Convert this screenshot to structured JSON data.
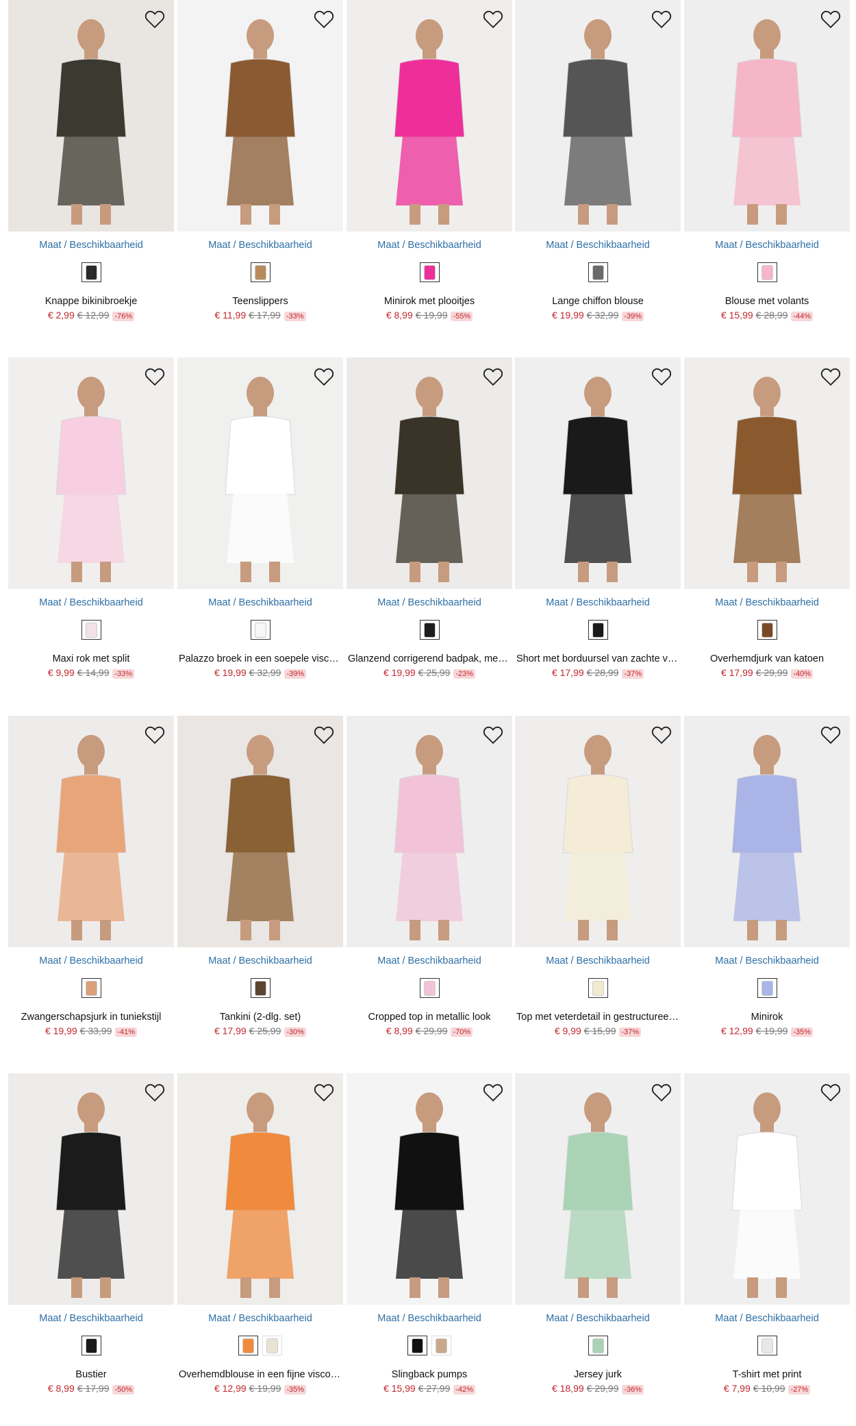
{
  "availability_label": "Maat / Beschikbaarheid",
  "products": [
    {
      "name": "Knappe bikinibroekje",
      "price": "€ 2,99",
      "old_price": "€ 12,99",
      "discount": "-76%",
      "bg": "#e9e6e2",
      "garment": "#3c3a30",
      "swatches": [
        "#2a2a2a"
      ]
    },
    {
      "name": "Teenslippers",
      "price": "€ 11,99",
      "old_price": "€ 17,99",
      "discount": "-33%",
      "bg": "#f3f3f3",
      "garment": "#8a5a32",
      "swatches": [
        "#b88a5c"
      ]
    },
    {
      "name": "Minirok met plooitjes",
      "price": "€ 8,99",
      "old_price": "€ 19,99",
      "discount": "-55%",
      "bg": "#efeeec",
      "garment": "#ee2f9a",
      "swatches": [
        "#ee2f9a"
      ]
    },
    {
      "name": "Lange chiffon blouse",
      "price": "€ 19,99",
      "old_price": "€ 32,99",
      "discount": "-39%",
      "bg": "#efefef",
      "garment": "#555555",
      "swatches": [
        "#6a6a6a"
      ]
    },
    {
      "name": "Blouse met volants",
      "price": "€ 15,99",
      "old_price": "€ 28,99",
      "discount": "-44%",
      "bg": "#efeeee",
      "garment": "#f5b6c8",
      "swatches": [
        "#f5b6c8"
      ]
    },
    {
      "name": "Maxi rok met split",
      "price": "€ 9,99",
      "old_price": "€ 14,99",
      "discount": "-33%",
      "bg": "#f1efee",
      "garment": "#f7cfe0",
      "swatches": [
        "#f4e1e6"
      ]
    },
    {
      "name": "Palazzo broek in een soepele viscose kwaliteit",
      "price": "€ 19,99",
      "old_price": "€ 32,99",
      "discount": "-39%",
      "bg": "#f0f0ef",
      "garment": "#ffffff",
      "swatches": [
        "#f7f7f7"
      ]
    },
    {
      "name": "Glanzend corrigerend badpak, medium shape",
      "price": "€ 19,99",
      "old_price": "€ 25,99",
      "discount": "-23%",
      "bg": "#ecebe9",
      "garment": "#3a3327",
      "swatches": [
        "#1d1d1d"
      ]
    },
    {
      "name": "Short met borduursel van zachte viscose",
      "price": "€ 17,99",
      "old_price": "€ 28,99",
      "discount": "-37%",
      "bg": "#efefef",
      "garment": "#1a1a1a",
      "swatches": [
        "#1a1a1a"
      ]
    },
    {
      "name": "Overhemdjurk van katoen",
      "price": "€ 17,99",
      "old_price": "€ 29,99",
      "discount": "-40%",
      "bg": "#efeeec",
      "garment": "#8a5a2e",
      "swatches": [
        "#7a4a26"
      ]
    },
    {
      "name": "Zwangerschapsjurk in tuniekstijl",
      "price": "€ 19,99",
      "old_price": "€ 33,99",
      "discount": "-41%",
      "bg": "#eeeceb",
      "garment": "#e8a57a",
      "swatches": [
        "#d9a07a"
      ]
    },
    {
      "name": "Tankini (2-dlg. set)",
      "price": "€ 17,99",
      "old_price": "€ 25,99",
      "discount": "-30%",
      "bg": "#e9e6e3",
      "garment": "#8a6035",
      "swatches": [
        "#5b4430"
      ]
    },
    {
      "name": "Cropped top in metallic look",
      "price": "€ 8,99",
      "old_price": "€ 29,99",
      "discount": "-70%",
      "bg": "#efeeee",
      "garment": "#f2c3d8",
      "swatches": [
        "#f2c3d8"
      ]
    },
    {
      "name": "Top met veterdetail in gestructureerde kwaliteit",
      "price": "€ 9,99",
      "old_price": "€ 15,99",
      "discount": "-37%",
      "bg": "#efeeed",
      "garment": "#f4ecd6",
      "swatches": [
        "#f2ead0"
      ]
    },
    {
      "name": "Minirok",
      "price": "€ 12,99",
      "old_price": "€ 19,99",
      "discount": "-35%",
      "bg": "#eeeeee",
      "garment": "#aab4e6",
      "swatches": [
        "#aab4e6"
      ]
    },
    {
      "name": "Bustier",
      "price": "€ 8,99",
      "old_price": "€ 17,99",
      "discount": "-50%",
      "bg": "#eeecea",
      "garment": "#1b1b1b",
      "swatches": [
        "#1b1b1b"
      ]
    },
    {
      "name": "Overhemdblouse in een fijne viscose kwaliteit",
      "price": "€ 12,99",
      "old_price": "€ 19,99",
      "discount": "-35%",
      "bg": "#efedea",
      "garment": "#f08a3c",
      "swatches": [
        "#f08a3c",
        "#e9e3d6"
      ]
    },
    {
      "name": "Slingback pumps",
      "price": "€ 15,99",
      "old_price": "€ 27,99",
      "discount": "-42%",
      "bg": "#f4f4f4",
      "garment": "#111111",
      "swatches": [
        "#111111",
        "#c9a98a"
      ]
    },
    {
      "name": "Jersey jurk",
      "price": "€ 18,99",
      "old_price": "€ 29,99",
      "discount": "-36%",
      "bg": "#efefef",
      "garment": "#a9d3b4",
      "swatches": [
        "#a9d3b4"
      ]
    },
    {
      "name": "T-shirt met print",
      "price": "€ 7,99",
      "old_price": "€ 10,99",
      "discount": "-27%",
      "bg": "#efefef",
      "garment": "#ffffff",
      "swatches": [
        "#e8e8e8"
      ]
    }
  ]
}
